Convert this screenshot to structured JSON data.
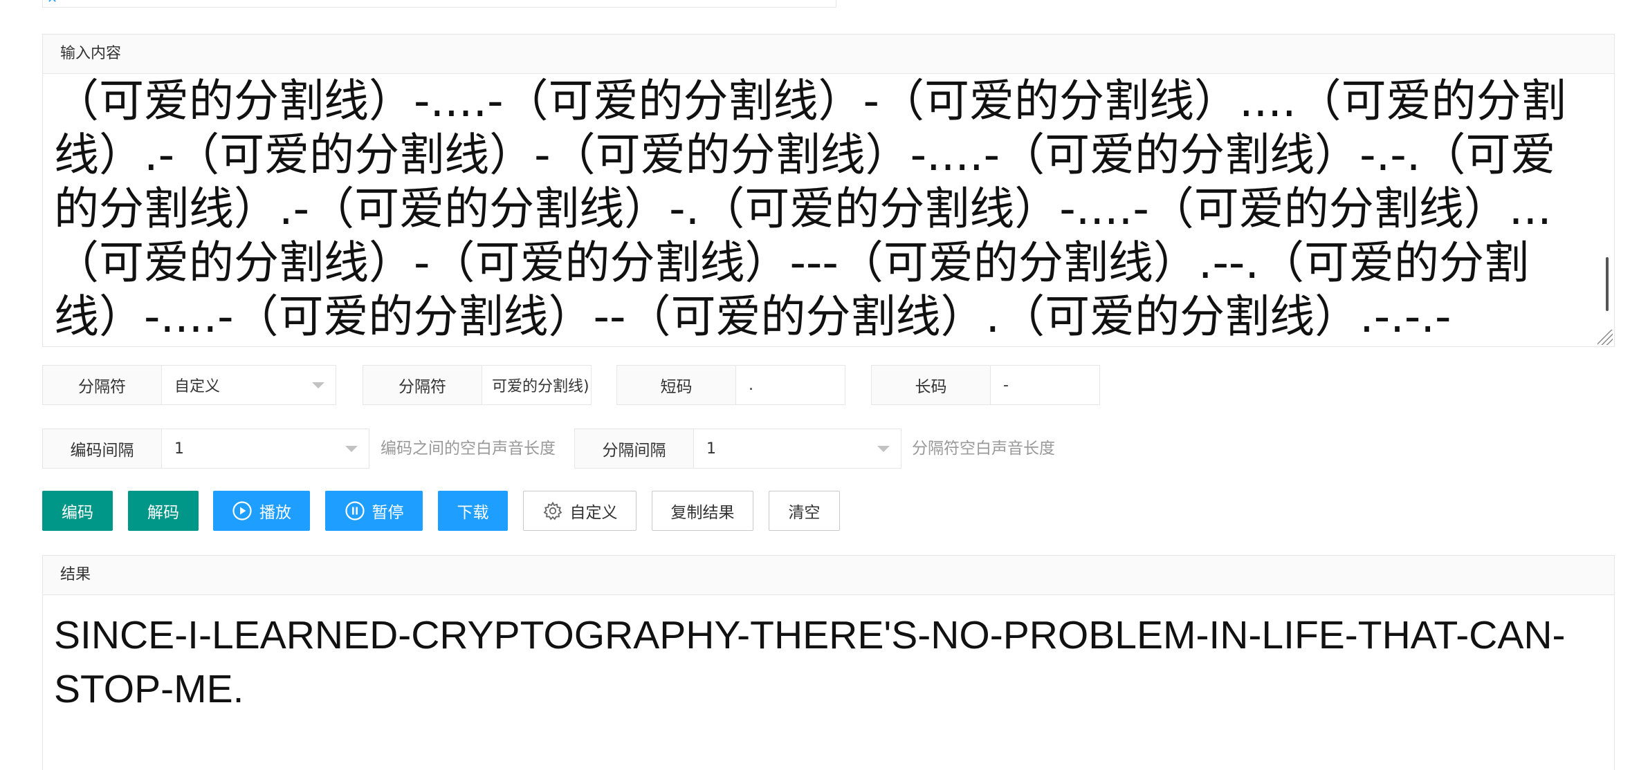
{
  "top_box": {
    "close_icon": "close-icon"
  },
  "input": {
    "header": "输入内容",
    "content": "（可爱的分割线）-....-（可爱的分割线）-（可爱的分割线）....（可爱的分割线）.-（可爱的分割线）-（可爱的分割线）-....-（可爱的分割线）-.-.（可爱的分割线）.-（可爱的分割线）-.（可爱的分割线）-....-（可爱的分割线）...（可爱的分割线）-（可爱的分割线）---（可爱的分割线）.--.（可爱的分割线）-....-（可爱的分割线）--（可爱的分割线）.（可爱的分割线）.-.-.-"
  },
  "options_row1": {
    "separator_type_label": "分隔符",
    "separator_type_value": "自定义",
    "separator_label": "分隔符",
    "separator_value": "可爱的分割线)",
    "short_label": "短码",
    "short_value": ".",
    "long_label": "长码",
    "long_value": "-"
  },
  "options_row2": {
    "code_gap_label": "编码间隔",
    "code_gap_value": "1",
    "code_gap_hint": "编码之间的空白声音长度",
    "sep_gap_label": "分隔间隔",
    "sep_gap_value": "1",
    "sep_gap_hint": "分隔符空白声音长度"
  },
  "buttons": {
    "encode": "编码",
    "decode": "解码",
    "play": "播放",
    "pause": "暂停",
    "download": "下载",
    "custom": "自定义",
    "copy": "复制结果",
    "clear": "清空"
  },
  "colors": {
    "teal": "#009688",
    "blue": "#1e9fff"
  },
  "result": {
    "header": "结果",
    "content": "SINCE-I-LEARNED-CRYPTOGRAPHY-THERE'S-NO-PROBLEM-IN-LIFE-THAT-CAN-STOP-ME."
  }
}
